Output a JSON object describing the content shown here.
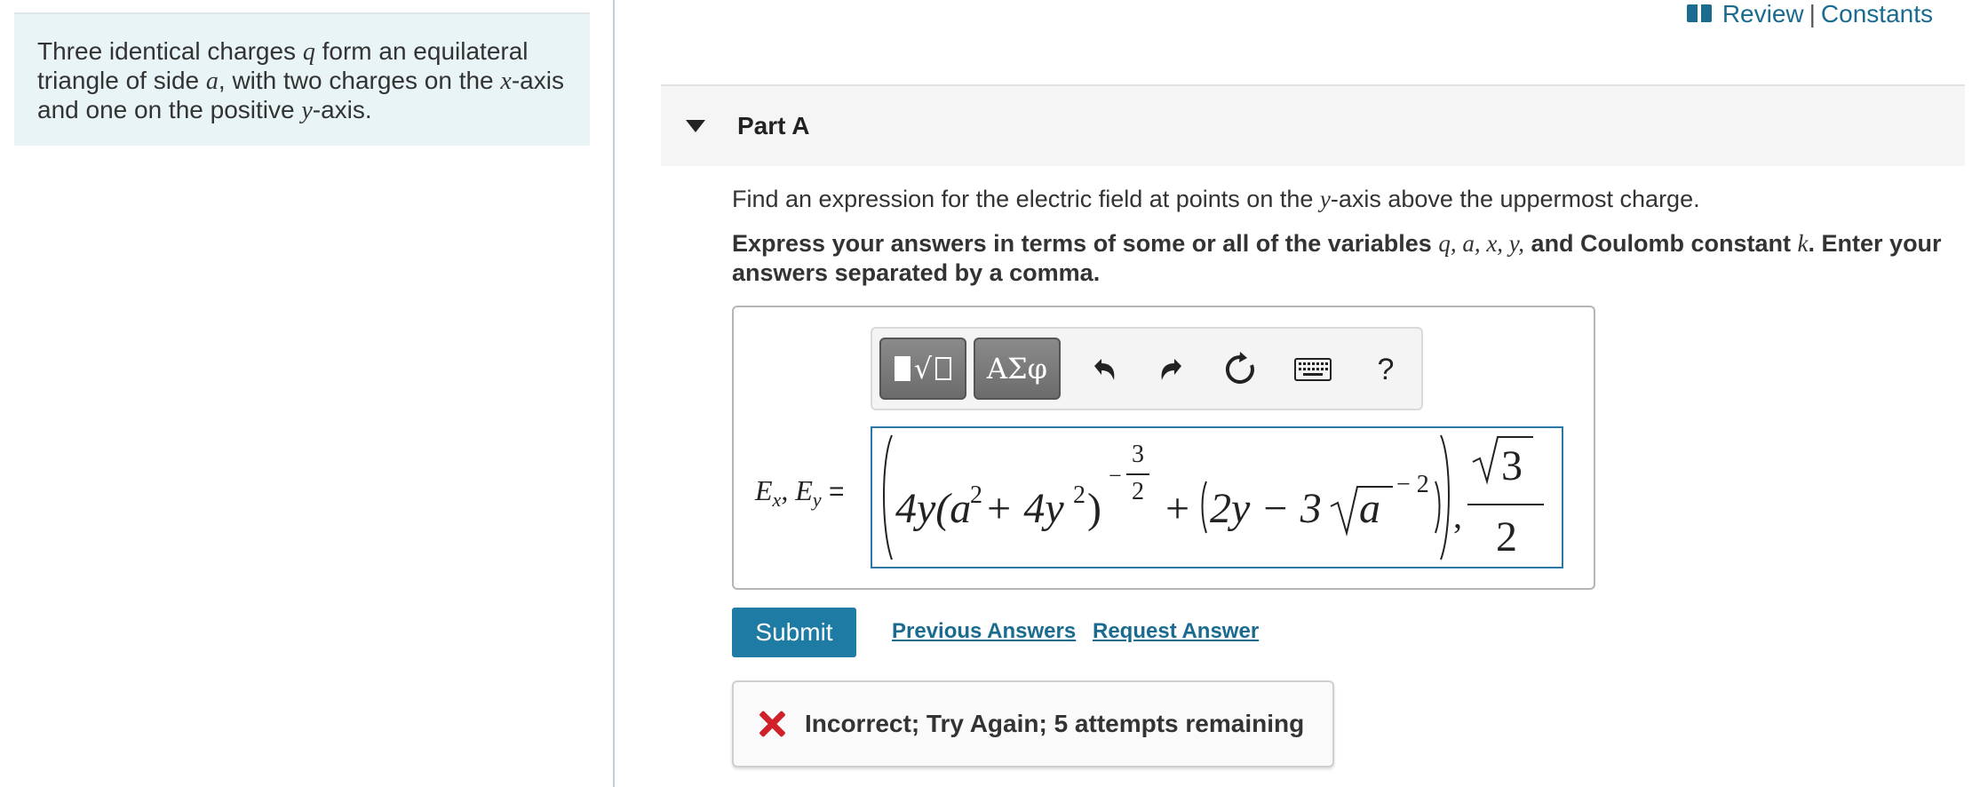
{
  "intro": {
    "line1_a": "Three identical charges ",
    "line1_q": "q",
    "line1_b": " form an equilateral",
    "line2_a": "triangle of side ",
    "line2_a_var": "a",
    "line2_b": ", with two charges on the ",
    "line2_x": "x",
    "line2_c": "-axis",
    "line3_a": "and one on the positive ",
    "line3_y": "y",
    "line3_b": "-axis."
  },
  "header": {
    "review": "Review",
    "separator": "|",
    "constants": "Constants"
  },
  "part": {
    "title": "Part A"
  },
  "question": {
    "a": "Find an expression for the electric field at points on the ",
    "y": "y",
    "b": "-axis above the uppermost charge."
  },
  "instruction": {
    "a": "Express your answers in terms of some or all of the variables ",
    "vars": "q, a, x, y,",
    "b": " and Coulomb constant ",
    "k": "k",
    "c": ". Enter your answers separated by a comma."
  },
  "toolbar": {
    "greek": "ΑΣφ",
    "help": "?"
  },
  "answer": {
    "label_ex": "E",
    "label_ex_sub": "x",
    "label_comma": ", ",
    "label_ey": "E",
    "label_ey_sub": "y",
    "label_eq": " =",
    "expr_4y": "4y(a",
    "expr_sq1": "2",
    "expr_plus1": " + 4y",
    "expr_sq2": "2",
    "expr_close": ")",
    "exp_minus": "−",
    "exp_num": "3",
    "exp_den": "2",
    "expr_plus2": "+",
    "expr_2y": "2y − 3",
    "expr_sqrt_a": "a",
    "expr_neg2": "− 2",
    "expr_comma": ",",
    "frac_num": "3",
    "frac_den": "2"
  },
  "actions": {
    "submit": "Submit",
    "previous": "Previous Answers",
    "request": "Request Answer"
  },
  "feedback": {
    "text": "Incorrect; Try Again; 5 attempts remaining"
  }
}
